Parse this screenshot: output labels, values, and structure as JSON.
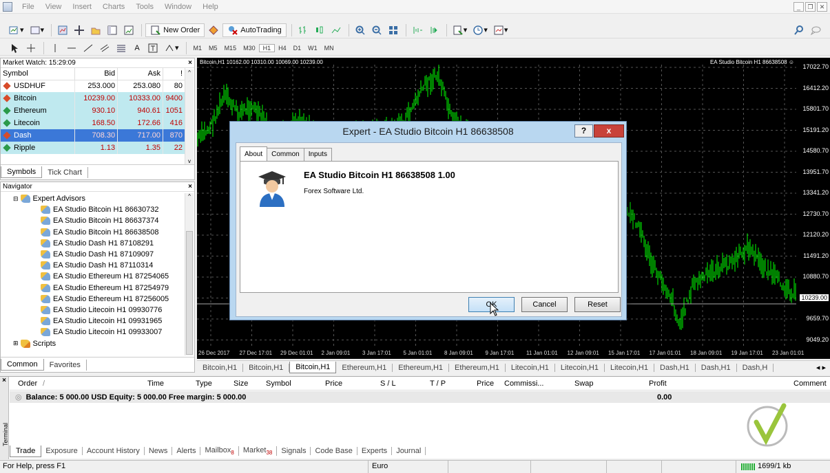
{
  "menu": [
    "File",
    "View",
    "Insert",
    "Charts",
    "Tools",
    "Window",
    "Help"
  ],
  "toolbar": {
    "new_order": "New Order",
    "autotrading": "AutoTrading"
  },
  "periods": [
    "M1",
    "M5",
    "M15",
    "M30",
    "H1",
    "H4",
    "D1",
    "W1",
    "MN"
  ],
  "market_watch": {
    "title": "Market Watch: 15:29:09",
    "columns": [
      "Symbol",
      "Bid",
      "Ask",
      "!"
    ],
    "rows": [
      {
        "symbol": "USDHUF",
        "bid": "253.000",
        "ask": "253.080",
        "spread": "80",
        "style": "plain",
        "dir": "down"
      },
      {
        "symbol": "Bitcoin",
        "bid": "10239.00",
        "ask": "10333.00",
        "spread": "9400",
        "style": "cyan",
        "dir": "down"
      },
      {
        "symbol": "Ethereum",
        "bid": "930.10",
        "ask": "940.61",
        "spread": "1051",
        "style": "cyan",
        "dir": "up"
      },
      {
        "symbol": "Litecoin",
        "bid": "168.50",
        "ask": "172.66",
        "spread": "416",
        "style": "cyan",
        "dir": "up"
      },
      {
        "symbol": "Dash",
        "bid": "708.30",
        "ask": "717.00",
        "spread": "870",
        "style": "sel",
        "dir": "down"
      },
      {
        "symbol": "Ripple",
        "bid": "1.13",
        "ask": "1.35",
        "spread": "22",
        "style": "cyan",
        "dir": "up"
      }
    ],
    "tabs": [
      "Symbols",
      "Tick Chart"
    ]
  },
  "navigator": {
    "title": "Navigator",
    "root": "Expert Advisors",
    "items": [
      "EA Studio Bitcoin H1 86630732",
      "EA Studio Bitcoin H1 86637374",
      "EA Studio Bitcoin H1 86638508",
      "EA Studio Dash H1 87108291",
      "EA Studio Dash H1 87109097",
      "EA Studio Dash H1 87110314",
      "EA Studio Ethereum H1 87254065",
      "EA Studio Ethereum H1 87254979",
      "EA Studio Ethereum H1 87256005",
      "EA Studio Litecoin H1 09930776",
      "EA Studio Litecoin H1 09931965",
      "EA Studio Litecoin H1 09933007"
    ],
    "scripts": "Scripts",
    "tabs": [
      "Common",
      "Favorites"
    ]
  },
  "chart": {
    "info": "Bitcoin,H1  10162.00 10310.00 10069.00 10239.00",
    "ea_label": "EA Studio Bitcoin H1 86638508",
    "y_ticks": [
      "17022.70",
      "16412.20",
      "15801.70",
      "15191.20",
      "14580.70",
      "13951.70",
      "13341.20",
      "12730.70",
      "12120.20",
      "11491.20",
      "10880.70",
      "10239.00",
      "9659.70",
      "9049.20"
    ],
    "current_price": "10239.00",
    "x_ticks": [
      "26 Dec 2017",
      "27 Dec 17:01",
      "29 Dec 01:01",
      "2 Jan 09:01",
      "3 Jan 17:01",
      "5 Jan 01:01",
      "8 Jan 09:01",
      "9 Jan 17:01",
      "11 Jan 01:01",
      "12 Jan 09:01",
      "15 Jan 17:01",
      "17 Jan 01:01",
      "18 Jan 09:01",
      "19 Jan 17:01",
      "23 Jan 01:01"
    ]
  },
  "chart_tabs": [
    "Bitcoin,H1",
    "Bitcoin,H1",
    "Bitcoin,H1",
    "Ethereum,H1",
    "Ethereum,H1",
    "Ethereum,H1",
    "Litecoin,H1",
    "Litecoin,H1",
    "Litecoin,H1",
    "Dash,H1",
    "Dash,H1",
    "Dash,H"
  ],
  "dialog": {
    "title": "Expert - EA Studio Bitcoin H1 86638508",
    "help": "?",
    "close": "x",
    "tabs": [
      "About",
      "Common",
      "Inputs"
    ],
    "ea_name": "EA Studio Bitcoin H1 86638508 1.00",
    "company": "Forex Software Ltd.",
    "ok": "OK",
    "cancel": "Cancel",
    "reset": "Reset"
  },
  "terminal": {
    "side_label": "Terminal",
    "columns": [
      "Order",
      "/",
      "Time",
      "Type",
      "Size",
      "Symbol",
      "Price",
      "S / L",
      "T / P",
      "Price",
      "Commissi...",
      "Swap",
      "Profit",
      "Comment"
    ],
    "balance": "Balance: 5 000.00 USD  Equity: 5 000.00  Free margin: 5 000.00",
    "profit": "0.00",
    "tabs": [
      {
        "label": "Trade",
        "badge": ""
      },
      {
        "label": "Exposure",
        "badge": ""
      },
      {
        "label": "Account History",
        "badge": ""
      },
      {
        "label": "News",
        "badge": ""
      },
      {
        "label": "Alerts",
        "badge": ""
      },
      {
        "label": "Mailbox",
        "badge": "8"
      },
      {
        "label": "Market",
        "badge": "38"
      },
      {
        "label": "Signals",
        "badge": ""
      },
      {
        "label": "Code Base",
        "badge": ""
      },
      {
        "label": "Experts",
        "badge": ""
      },
      {
        "label": "Journal",
        "badge": ""
      }
    ]
  },
  "status": {
    "help": "For Help, press F1",
    "profile": "Euro",
    "traffic": "1699/1 kb"
  },
  "colors": {
    "chart_bg": "#000000",
    "candle": "#00ff00",
    "selection": "#3b78d8",
    "cyan_row": "#bfe9ef",
    "dialog_frame": "#b9d7f0",
    "close_btn": "#c8423a"
  }
}
